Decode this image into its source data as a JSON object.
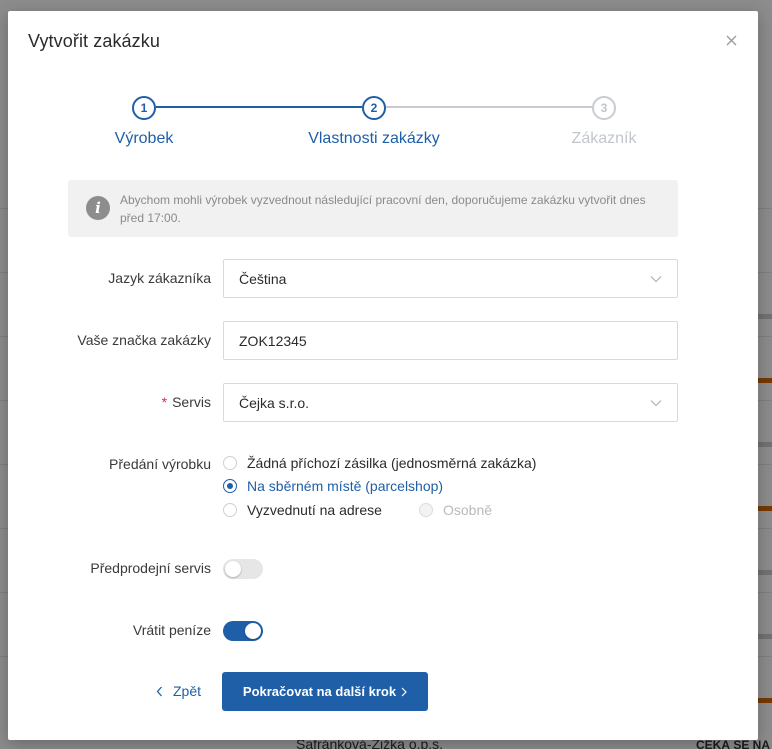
{
  "modal": {
    "title": "Vytvořit zakázku"
  },
  "stepper": {
    "steps": [
      {
        "number": "1",
        "label": "Výrobek",
        "state": "done"
      },
      {
        "number": "2",
        "label": "Vlastnosti zakázky",
        "state": "active"
      },
      {
        "number": "3",
        "label": "Zákazník",
        "state": "inactive"
      }
    ]
  },
  "info": {
    "text": "Abychom mohli výrobek vyzvednout následující pracovní den, doporučujeme zakázku vytvořit dnes před 17:00.",
    "icon": "info-icon"
  },
  "form": {
    "language": {
      "label": "Jazyk zákazníka",
      "value": "Čeština"
    },
    "reference": {
      "label": "Vaše značka zakázky",
      "value": "ZOK12345"
    },
    "service": {
      "label": "Servis",
      "required_mark": "*",
      "value": "Čejka s.r.o."
    },
    "handover": {
      "label": "Předání výrobku",
      "options": [
        {
          "label": "Žádná příchozí zásilka (jednosměrná zakázka)",
          "checked": false
        },
        {
          "label": "Na sběrném místě (parcelshop)",
          "checked": true
        },
        {
          "label": "Vyzvednutí na adrese",
          "checked": false
        },
        {
          "label": "Osobně",
          "checked": false,
          "disabled": true
        }
      ]
    },
    "presale": {
      "label": "Předprodejní servis",
      "on": false
    },
    "refund": {
      "label": "Vrátit peníze",
      "on": true
    }
  },
  "footer": {
    "back_label": "Zpět",
    "next_label": "Pokračovat na další krok"
  },
  "background": {
    "bottom_company": "Šafránková-Žižka o.p.s.",
    "bottom_status": "ČEKÁ SE NA"
  },
  "colors": {
    "accent": "#1f5fa8",
    "required": "#e0283a",
    "orange_status": "#d86a00"
  }
}
